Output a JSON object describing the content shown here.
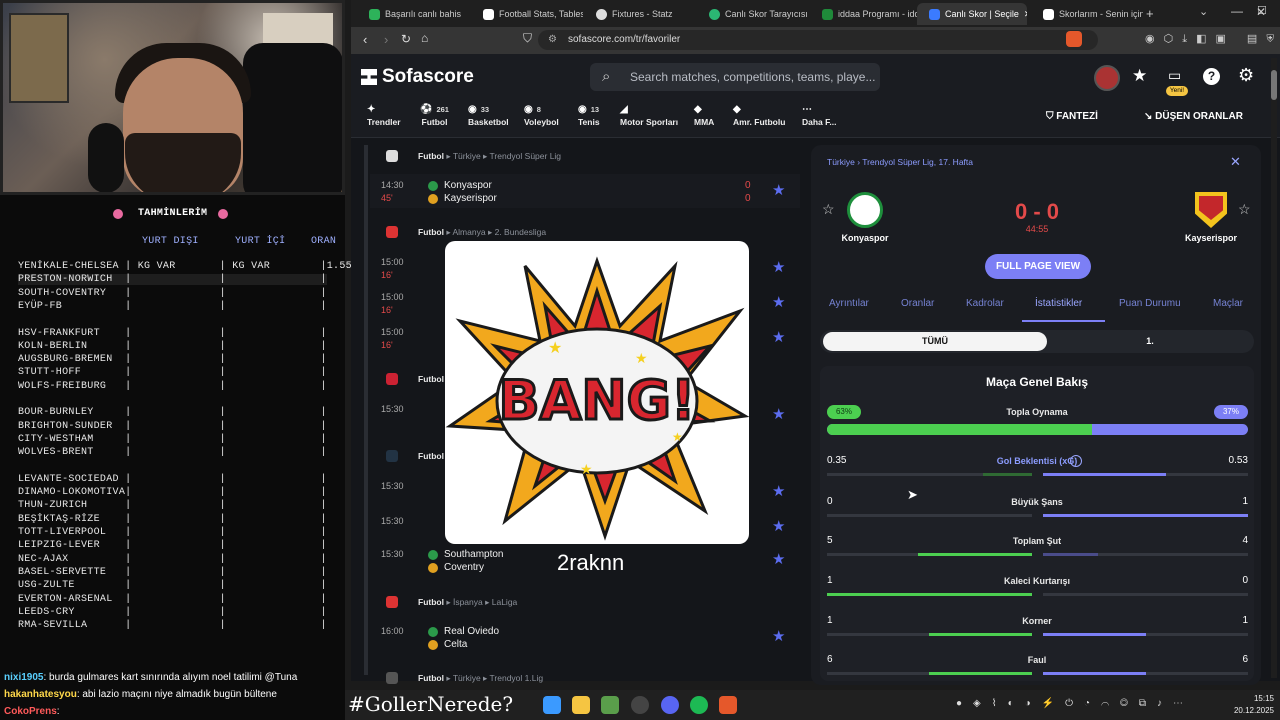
{
  "stream": {
    "predictions_title": "TAHMİNLERİM",
    "columns": [
      "YURT DIŞI",
      "YURT İÇİ",
      "ORAN"
    ],
    "rows": [
      "YENİKALE-CHELSEA | KG VAR       | KG VAR        |1.55",
      "PRESTON-NORWICH  |              |               |",
      "SOUTH-COVENTRY   |              |               |",
      "EYÜP-FB          |              |               |",
      "",
      "HSV-FRANKFURT    |              |               |",
      "KOLN-BERLIN      |              |               |",
      "AUGSBURG-BREMEN  |              |               |",
      "STUTT-HOFF       |              |               |",
      "WOLFS-FREIBURG   |              |               |",
      "",
      "BOUR-BURNLEY     |              |               |",
      "BRIGHTON-SUNDER  |              |               |",
      "CITY-WESTHAM     |              |               |",
      "WOLVES-BRENT     |              |               |",
      "",
      "LEVANTE-SOCIEDAD |              |               |",
      "DINAMO-LOKOMOTIVA|              |               |",
      "THUN-ZURICH      |              |               |",
      "BEŞİKTAŞ-RİZE    |              |               |",
      "TOTT-LIVERPOOL   |              |               |",
      "LEIPZIG-LEVER    |              |               |",
      "NEC-AJAX         |              |               |",
      "BASEL-SERVETTE   |              |               |",
      "USG-ZULTE        |              |               |",
      "EVERTON-ARSENAL  |              |               |",
      "LEEDS-CRY        |              |               |",
      "RMA-SEVILLA      |              |               |"
    ],
    "chat": [
      {
        "user": "nixi1905",
        "text": ": burda gulmares kart sınırında alıyım noel tatilimi @Tuna",
        "color": "#5ad0ff"
      },
      {
        "user": "hakanhatesyou",
        "text": ": abi lazio maçını niye almadık bugün bültene",
        "color": "#ffd84a"
      },
      {
        "user": "CokoPrens",
        "text": ":",
        "color": "#ff5a5a"
      }
    ],
    "hashtag": "#GollerNerede?"
  },
  "browser": {
    "tabs": [
      {
        "label": "Başarılı canlı bahis",
        "color": "#2db35a"
      },
      {
        "label": "Football Stats, Tables (",
        "color": "#ffffff"
      },
      {
        "label": "Fixtures - Statz",
        "color": "#dddddd"
      },
      {
        "label": "Canlı Skor Tarayıcısı ve",
        "color": "#2bb673"
      },
      {
        "label": "iddaa Programı - idda",
        "color": "#1f8a3a"
      },
      {
        "label": "Canlı Skor | Seçile",
        "color": "#3b7bff"
      },
      {
        "label": "Skorlarım - Senin için",
        "color": "#ffffff"
      }
    ],
    "url": "sofascore.com/tr/favoriler"
  },
  "site": {
    "logo": "Sofascore",
    "search_placeholder": "Search matches, competitions, teams, playe...",
    "new_badge": "Yeni!",
    "sports": [
      {
        "label": "Trendler",
        "count": ""
      },
      {
        "label": "Futbol",
        "count": "261"
      },
      {
        "label": "Basketbol",
        "count": "33"
      },
      {
        "label": "Voleybol",
        "count": "8"
      },
      {
        "label": "Tenis",
        "count": "13"
      },
      {
        "label": "Motor Sporları",
        "count": ""
      },
      {
        "label": "MMA",
        "count": ""
      },
      {
        "label": "Amr. Futbolu",
        "count": ""
      },
      {
        "label": "Daha F...",
        "count": ""
      }
    ],
    "fantezi": "FANTEZİ",
    "dusen": "DÜŞEN ORANLAR",
    "leagues": [
      {
        "sport": "Futbol",
        "country": "Türkiye",
        "league": "Trendyol Süper Lig"
      },
      {
        "sport": "Futbol",
        "country": "Almanya",
        "league": "2. Bundesliga"
      },
      {
        "sport": "Futbol",
        "country": "",
        "league": ""
      },
      {
        "sport": "Futbol",
        "country": "",
        "league": ""
      },
      {
        "sport": "Futbol",
        "country": "İspanya",
        "league": "LaLiga"
      },
      {
        "sport": "Futbol",
        "country": "Türkiye",
        "league": "Trendyol 1.Lig"
      }
    ],
    "matches": [
      {
        "time": "14:30",
        "min": "45'",
        "home": "Konyaspor",
        "away": "Kayserispor",
        "hs": "0",
        "as": "0"
      },
      {
        "time": "15:00",
        "min": "16'",
        "home": "",
        "away": "",
        "hs": "",
        "as": ""
      },
      {
        "time": "15:00",
        "min": "16'",
        "home": "",
        "away": "",
        "hs": "",
        "as": ""
      },
      {
        "time": "15:00",
        "min": "16'",
        "home": "",
        "away": "",
        "hs": "",
        "as": ""
      },
      {
        "time": "15:30",
        "min": "",
        "home": "",
        "away": "",
        "hs": "",
        "as": ""
      },
      {
        "time": "15:30",
        "min": "",
        "home": "",
        "away": "",
        "hs": "",
        "as": ""
      },
      {
        "time": "15:30",
        "min": "",
        "home": "",
        "away": "",
        "hs": "",
        "as": ""
      },
      {
        "time": "15:30",
        "min": "",
        "home": "Southampton",
        "away": "Coventry",
        "hs": "",
        "as": ""
      },
      {
        "time": "16:00",
        "min": "",
        "home": "Real Oviedo",
        "away": "Celta",
        "hs": "",
        "as": ""
      }
    ],
    "overlay_text": "BANG!",
    "overlay_user": "2raknn",
    "detail": {
      "breadcrumb_country": "Türkiye",
      "breadcrumb_league": "Trendyol Süper Lig, 17. Hafta",
      "home": "Konyaspor",
      "away": "Kayserispor",
      "score": "0 - 0",
      "clock": "44:55",
      "full_page": "FULL PAGE VIEW",
      "tabs": [
        "Ayrıntılar",
        "Oranlar",
        "Kadrolar",
        "İstatistikler",
        "Puan Durumu",
        "Maçlar"
      ],
      "period_tabs": [
        "TÜMÜ",
        "1."
      ],
      "overview_title": "Maça Genel Bakış",
      "possession": {
        "label": "Topla Oynama",
        "home": "63%",
        "away": "37%",
        "home_value": 63
      },
      "stats": [
        {
          "label": "Gol Beklentisi (xG)",
          "home": "0.35",
          "away": "0.53",
          "hv": 0.35,
          "av": 0.53
        },
        {
          "label": "Büyük Şans",
          "home": "0",
          "away": "1",
          "hv": 0,
          "av": 1
        },
        {
          "label": "Toplam Şut",
          "home": "5",
          "away": "4",
          "hv": 5,
          "av": 4
        },
        {
          "label": "Kaleci Kurtarışı",
          "home": "1",
          "away": "0",
          "hv": 1,
          "av": 0
        },
        {
          "label": "Korner",
          "home": "1",
          "away": "1",
          "hv": 1,
          "av": 1
        },
        {
          "label": "Faul",
          "home": "6",
          "away": "6",
          "hv": 6,
          "av": 6
        }
      ]
    }
  },
  "taskbar": {
    "time": "15:15",
    "date": "20.12.2025"
  }
}
